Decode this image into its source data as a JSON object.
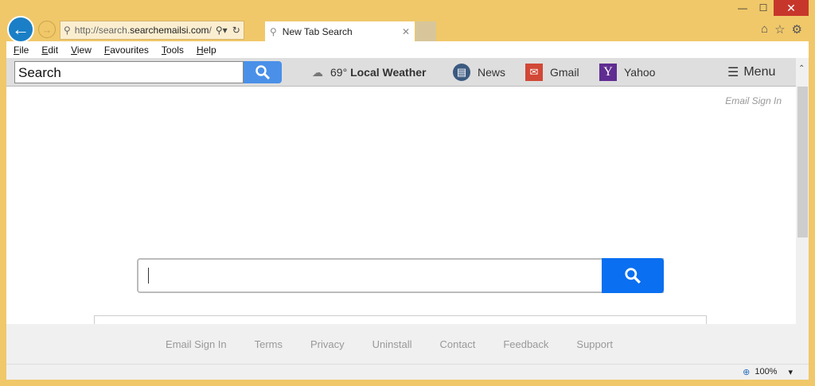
{
  "window": {
    "minimize": "—",
    "maximize": "☐",
    "close": "✕"
  },
  "nav": {
    "back": "←",
    "forward": "→"
  },
  "address": {
    "prefix": "http://search.",
    "domain": "searchemailsi.com",
    "suffix": "/"
  },
  "tab": {
    "title": "New Tab Search"
  },
  "menu": [
    "File",
    "Edit",
    "View",
    "Favourites",
    "Tools",
    "Help"
  ],
  "toolbar": {
    "search_placeholder": "Search",
    "weather_temp": "69°",
    "weather_label": "Local Weather",
    "news": "News",
    "gmail": "Gmail",
    "yahoo": "Yahoo",
    "menu": "Menu"
  },
  "content": {
    "email_sign_in": "Email Sign In"
  },
  "footer": [
    "Email Sign In",
    "Terms",
    "Privacy",
    "Uninstall",
    "Contact",
    "Feedback",
    "Support"
  ],
  "status": {
    "zoom": "100%"
  },
  "colors": {
    "frame": "#f0c86a",
    "search_button": "#0a6ff0",
    "gmail": "#d14836",
    "yahoo": "#5f2d91"
  }
}
